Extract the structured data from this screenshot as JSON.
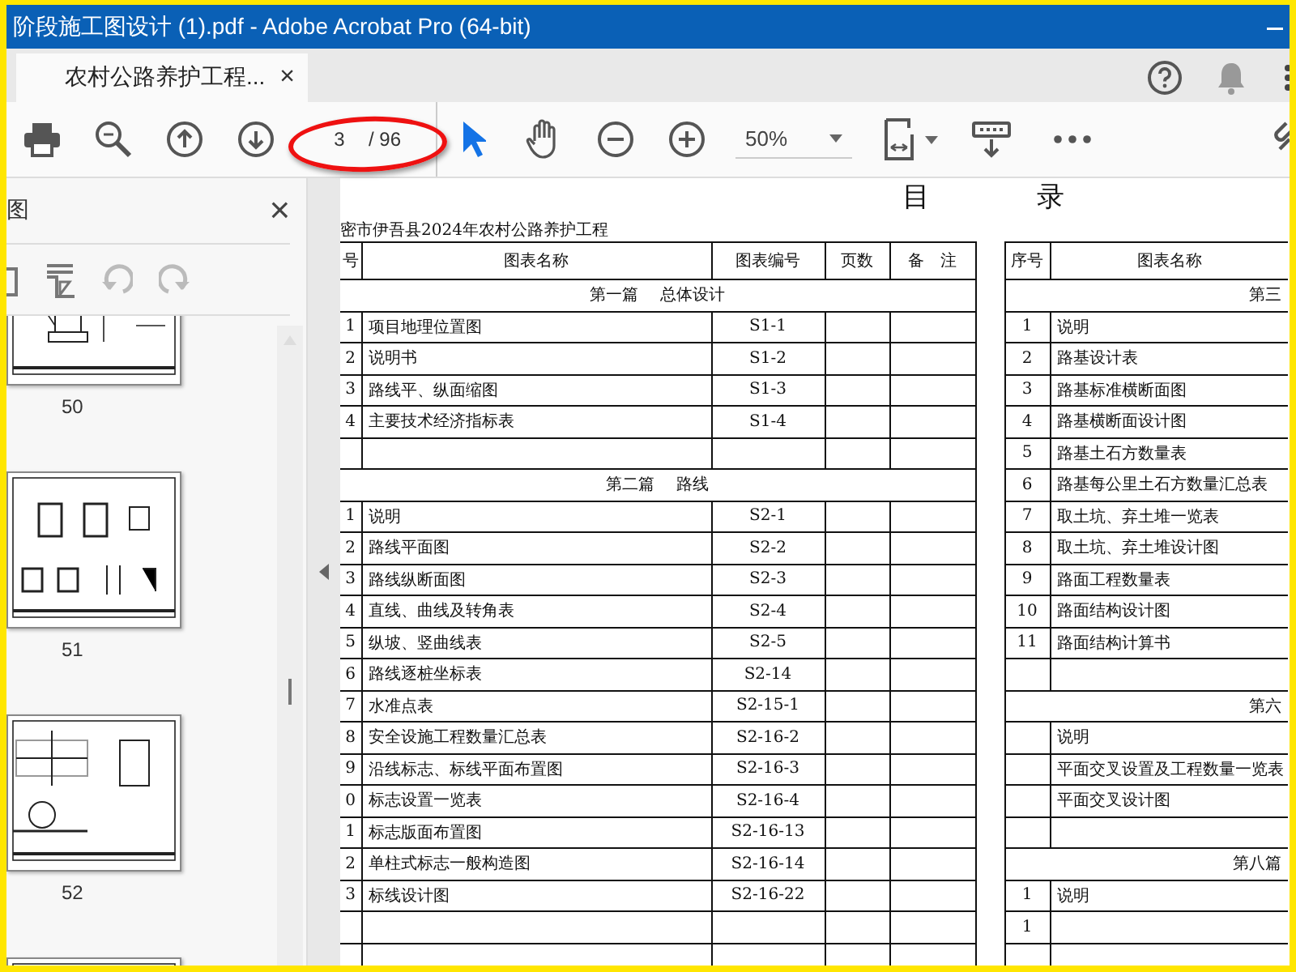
{
  "window": {
    "title": "阶段施工图设计 (1).pdf - Adobe Acrobat Pro (64-bit)"
  },
  "tab": {
    "label": "农村公路养护工程...",
    "close": "×"
  },
  "toolbar": {
    "page_current": "3",
    "page_total": "/ 96",
    "zoom": "50%"
  },
  "sidebar": {
    "title": "图",
    "close": "×",
    "thumbnails": [
      {
        "kind": "page",
        "label": "50"
      },
      {
        "kind": "page",
        "label": "51"
      },
      {
        "kind": "page",
        "label": "52"
      },
      {
        "kind": "page"
      }
    ]
  },
  "document": {
    "heading": [
      "目",
      "录"
    ],
    "project": "密市伊吾县2024年农村公路养护工程",
    "tables": [
      {
        "columns": [
          "号",
          "图表名称",
          "图表编号",
          "页数",
          "备　注"
        ],
        "rows": [
          {
            "kind": "section",
            "title": "第一篇　 总体设计"
          },
          {
            "kind": "item",
            "no": "1",
            "name": "项目地理位置图",
            "code": "S1-1"
          },
          {
            "kind": "item",
            "no": "2",
            "name": "说明书",
            "code": "S1-2"
          },
          {
            "kind": "item",
            "no": "3",
            "name": "路线平、纵面缩图",
            "code": "S1-3"
          },
          {
            "kind": "item",
            "no": "4",
            "name": "主要技术经济指标表",
            "code": "S1-4"
          },
          {
            "kind": "blank"
          },
          {
            "kind": "section",
            "title": "第二篇　 路线"
          },
          {
            "kind": "item",
            "no": "1",
            "name": "说明",
            "code": "S2-1"
          },
          {
            "kind": "item",
            "no": "2",
            "name": "路线平面图",
            "code": "S2-2"
          },
          {
            "kind": "item",
            "no": "3",
            "name": "路线纵断面图",
            "code": "S2-3"
          },
          {
            "kind": "item",
            "no": "4",
            "name": "直线、曲线及转角表",
            "code": "S2-4"
          },
          {
            "kind": "item",
            "no": "5",
            "name": "纵坡、竖曲线表",
            "code": "S2-5"
          },
          {
            "kind": "item",
            "no": "6",
            "name": "路线逐桩坐标表",
            "code": "S2-14"
          },
          {
            "kind": "item",
            "no": "7",
            "name": "水准点表",
            "code": "S2-15-1"
          },
          {
            "kind": "item",
            "no": "8",
            "name": "安全设施工程数量汇总表",
            "code": "S2-16-2"
          },
          {
            "kind": "item",
            "no": "9",
            "name": "沿线标志、标线平面布置图",
            "code": "S2-16-3"
          },
          {
            "kind": "item",
            "no": "0",
            "name": "标志设置一览表",
            "code": "S2-16-4"
          },
          {
            "kind": "item",
            "no": "1",
            "name": "标志版面布置图",
            "code": "S2-16-13"
          },
          {
            "kind": "item",
            "no": "2",
            "name": "单柱式标志一般构造图",
            "code": "S2-16-14"
          },
          {
            "kind": "item",
            "no": "3",
            "name": "标线设计图",
            "code": "S2-16-22"
          },
          {
            "kind": "blank"
          },
          {
            "kind": "blank"
          }
        ]
      },
      {
        "columns": [
          "序号",
          "图表名称"
        ],
        "rows": [
          {
            "kind": "section",
            "title": "第三"
          },
          {
            "kind": "item",
            "no": "1",
            "name": "说明"
          },
          {
            "kind": "item",
            "no": "2",
            "name": "路基设计表"
          },
          {
            "kind": "item",
            "no": "3",
            "name": "路基标准横断面图"
          },
          {
            "kind": "item",
            "no": "4",
            "name": "路基横断面设计图"
          },
          {
            "kind": "item",
            "no": "5",
            "name": "路基土石方数量表"
          },
          {
            "kind": "item",
            "no": "6",
            "name": "路基每公里土石方数量汇总表"
          },
          {
            "kind": "item",
            "no": "7",
            "name": "取土坑、弃土堆一览表"
          },
          {
            "kind": "item",
            "no": "8",
            "name": "取土坑、弃土堆设计图"
          },
          {
            "kind": "item",
            "no": "9",
            "name": "路面工程数量表"
          },
          {
            "kind": "item",
            "no": "10",
            "name": "路面结构设计图"
          },
          {
            "kind": "item",
            "no": "11",
            "name": "路面结构计算书"
          },
          {
            "kind": "blank"
          },
          {
            "kind": "section",
            "title": "第六"
          },
          {
            "kind": "item",
            "name": "说明"
          },
          {
            "kind": "item",
            "name": "平面交叉设置及工程数量一览表"
          },
          {
            "kind": "item",
            "name": "平面交叉设计图"
          },
          {
            "kind": "blank"
          },
          {
            "kind": "section",
            "title": "第八篇"
          },
          {
            "kind": "item",
            "no": "1",
            "name": "说明"
          },
          {
            "kind": "item",
            "no": "1"
          },
          {
            "kind": "blank"
          }
        ]
      }
    ]
  }
}
